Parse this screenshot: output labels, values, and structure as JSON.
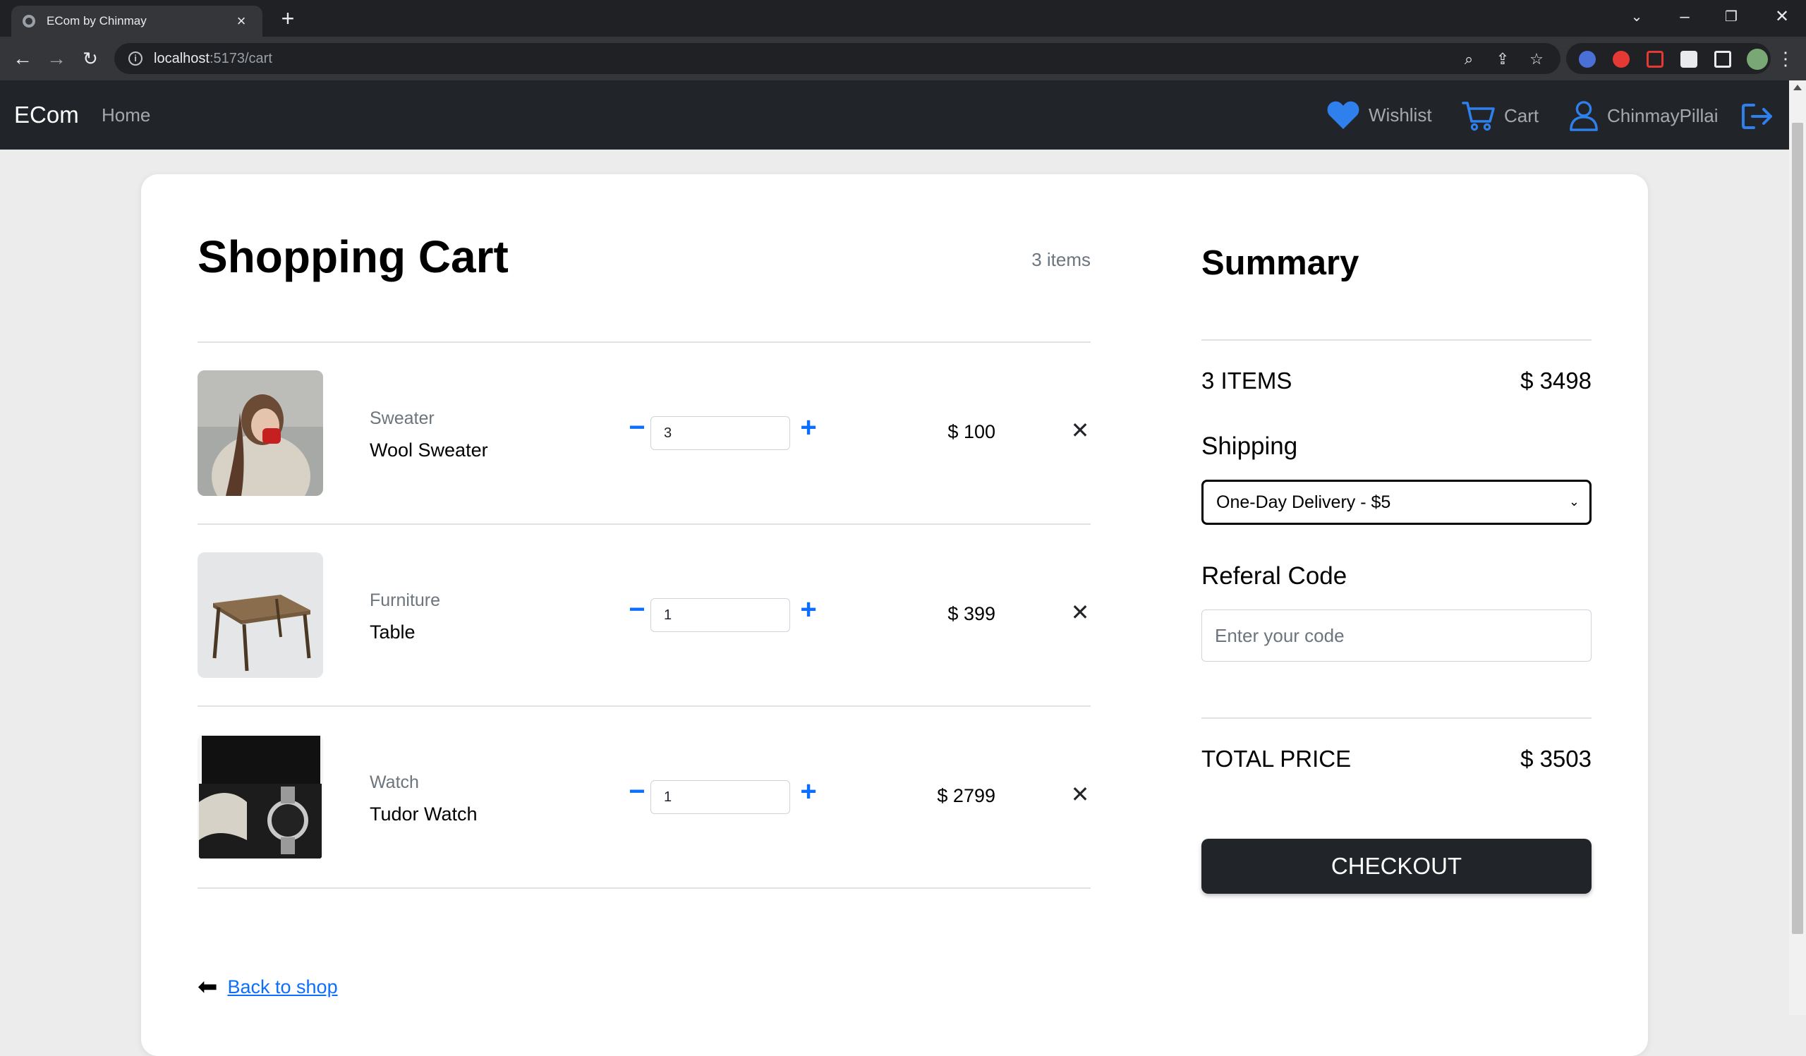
{
  "browser": {
    "tab_title": "ECom by Chinmay",
    "url_host": "localhost",
    "url_path": ":5173/cart"
  },
  "nav": {
    "brand": "ECom",
    "home": "Home",
    "wishlist": "Wishlist",
    "cart": "Cart",
    "user": "ChinmayPillai"
  },
  "cart": {
    "title": "Shopping Cart",
    "count_label": "3 items",
    "items": [
      {
        "category": "Sweater",
        "name": "Wool Sweater",
        "quantity": "3",
        "price": "$ 100"
      },
      {
        "category": "Furniture",
        "name": "Table",
        "quantity": "1",
        "price": "$ 399"
      },
      {
        "category": "Watch",
        "name": "Tudor Watch",
        "quantity": "1",
        "price": "$ 2799"
      }
    ],
    "back_label": "Back to shop"
  },
  "summary": {
    "title": "Summary",
    "items_label": "3 ITEMS",
    "items_total": "$ 3498",
    "shipping_label": "Shipping",
    "shipping_selected": "One-Day Delivery - $5",
    "referral_label": "Referal Code",
    "referral_placeholder": "Enter your code",
    "total_label": "TOTAL PRICE",
    "total_value": "$ 3503",
    "checkout_label": "CHECKOUT"
  },
  "colors": {
    "accent": "#0d6efd",
    "navbar": "#212529",
    "heart": "#2f80ed"
  }
}
